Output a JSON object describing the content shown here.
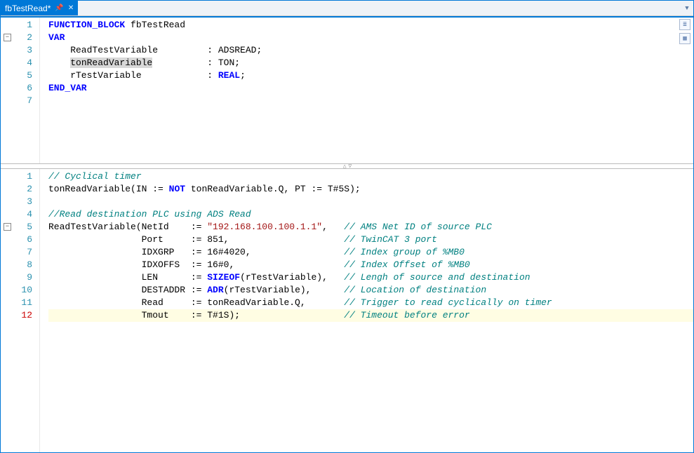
{
  "tab": {
    "title": "fbTestRead*",
    "pin_glyph": "📌",
    "close_glyph": "✕"
  },
  "splitter_grip": "△   ▽",
  "top_pane": {
    "lines": [
      {
        "n": 1,
        "html": "<span class='kw'>FUNCTION_BLOCK</span> fbTestRead"
      },
      {
        "n": 2,
        "fold": true,
        "html": "<span class='kw'>VAR</span>"
      },
      {
        "n": 3,
        "html": "    ReadTestVariable         : ADSREAD;"
      },
      {
        "n": 4,
        "html": "    <span class='sel'>tonReadVariable</span>          : TON;"
      },
      {
        "n": 5,
        "html": "    rTestVariable            : <span class='kw'>REAL</span>;"
      },
      {
        "n": 6,
        "html": "<span class='kw'>END_VAR</span>"
      },
      {
        "n": 7,
        "html": ""
      }
    ]
  },
  "bottom_pane": {
    "lines": [
      {
        "n": 1,
        "html": "<span class='cm'>// Cyclical timer</span>"
      },
      {
        "n": 2,
        "html": "tonReadVariable(IN := <span class='kw'>NOT</span> tonReadVariable.Q, PT := T#5S);"
      },
      {
        "n": 3,
        "html": ""
      },
      {
        "n": 4,
        "html": "<span class='cm'>//Read destination PLC using ADS Read</span>"
      },
      {
        "n": 5,
        "fold": true,
        "html": "ReadTestVariable(NetId    := <span class='st'>\"192.168.100.100.1.1\"</span>,   <span class='cm'>// AMS Net ID of source PLC</span>"
      },
      {
        "n": 6,
        "html": "                 Port     := 851,                     <span class='cm'>// TwinCAT 3 port</span>"
      },
      {
        "n": 7,
        "html": "                 IDXGRP   := 16#4020,                 <span class='cm'>// Index group of %MB0</span>"
      },
      {
        "n": 8,
        "html": "                 IDXOFFS  := 16#0,                    <span class='cm'>// Index Offset of %MB0</span>"
      },
      {
        "n": 9,
        "html": "                 LEN      := <span class='fn'>SIZEOF</span>(rTestVariable),   <span class='cm'>// Lengh of source and destination</span>"
      },
      {
        "n": 10,
        "html": "                 DESTADDR := <span class='fn'>ADR</span>(rTestVariable),      <span class='cm'>// Location of destination</span>"
      },
      {
        "n": 11,
        "html": "                 Read     := tonReadVariable.Q,       <span class='cm'>// Trigger to read cyclically on timer</span>"
      },
      {
        "n": 12,
        "err": true,
        "hl": true,
        "html": "                 Tmout    := T#1S);                   <span class='cm'>// Timeout before error</span>"
      }
    ]
  },
  "side_icons": [
    {
      "name": "view-mode-text-icon",
      "glyph": "≣"
    },
    {
      "name": "view-mode-table-icon",
      "glyph": "▦"
    }
  ],
  "dropdown_glyph": "▼"
}
